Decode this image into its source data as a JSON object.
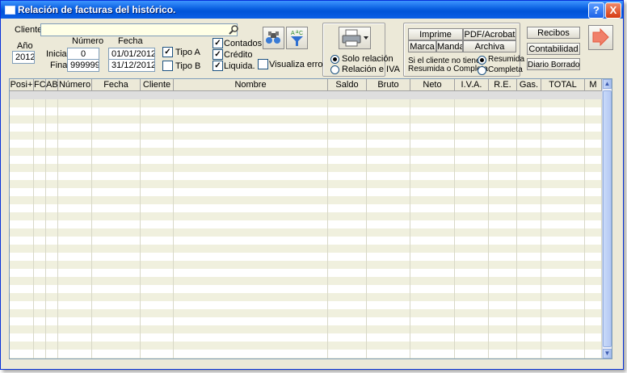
{
  "window": {
    "title": "Relación de facturas del histórico.",
    "help_label": "?",
    "close_label": "X"
  },
  "filters": {
    "cliente_label": "Cliente:",
    "cliente_value": "",
    "ano_label": "Año",
    "ano_value": "2012",
    "numero_label": "Número",
    "fecha_label": "Fecha",
    "inicial_label": "Inicial:",
    "final_label": "Final:",
    "numero_inicial": "0",
    "numero_final": "999999",
    "fecha_inicial": "01/01/2012",
    "fecha_final": "31/12/2012",
    "tipo_a_label": "Tipo A",
    "tipo_b_label": "Tipo B",
    "contados_label": "Contados",
    "credito_label": "Crédito",
    "liquida_label": "Liquida.",
    "visualiza_label": "Visualiza errores",
    "checks": {
      "tipo_a": true,
      "tipo_b": false,
      "contados": true,
      "credito": true,
      "liquida": true,
      "visualiza": false
    }
  },
  "print_options": {
    "solo_relacion": "Solo relación",
    "relacion_iva": "Relación e IVA",
    "selected": "solo_relacion"
  },
  "actions": {
    "imprime": "Imprime",
    "pdf": "PDF/Acrobat",
    "marca": "Marca",
    "manda": "Manda",
    "archiva": "Archiva",
    "note_line1": "Si el cliente no tiene",
    "note_line2": "Resumida o Completa",
    "resumida": "Resumida",
    "completa": "Completa",
    "selected": "resumida"
  },
  "side_buttons": {
    "recibos": "Recibos",
    "contabilidad": "Contabilidad",
    "diario": "Diario Borrador"
  },
  "icons": {
    "filter": "filter-icon",
    "sort": "sort-icon",
    "printer": "printer-icon",
    "exit": "exit-arrow-icon"
  },
  "colors": {
    "title_bar": "#0a5fe0",
    "exit_button": "#f08070",
    "row_alt": "#f0f0de",
    "cliente_field": "#ffffe6"
  },
  "table": {
    "columns": [
      "Posi+",
      "FC",
      "AB",
      "Número",
      "Fecha",
      "Cliente",
      "Nombre",
      "Saldo",
      "Bruto",
      "Neto",
      "I.V.A.",
      "R.E.",
      "Gas.",
      "TOTAL",
      "M"
    ]
  }
}
